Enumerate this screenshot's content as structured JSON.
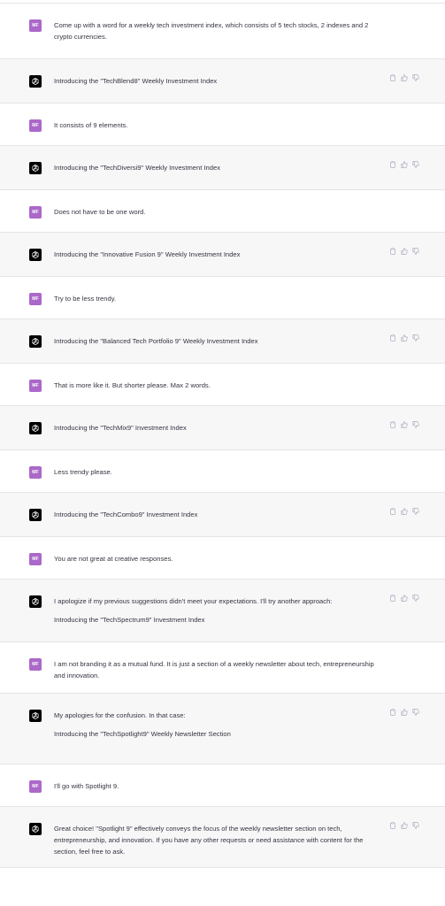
{
  "user": {
    "initials": "MF"
  },
  "icons": {
    "assistant_avatar": "openai-logo-icon",
    "copy": "clipboard-icon",
    "thumbs_up": "thumbs-up-icon",
    "thumbs_down": "thumbs-down-icon"
  },
  "colors": {
    "user_avatar": "#ab68c9",
    "assistant_avatar": "#000000",
    "assistant_background": "#f7f7f8"
  },
  "messages": [
    {
      "role": "user",
      "paragraphs": [
        "Come up with a word for a weekly tech investment index, which consists of 5 tech stocks, 2 indexes and 2 crypto currencies."
      ]
    },
    {
      "role": "assistant",
      "paragraphs": [
        "Introducing the \"TechBlend8\" Weekly Investment Index"
      ]
    },
    {
      "role": "user",
      "paragraphs": [
        "It consists of 9 elements."
      ]
    },
    {
      "role": "assistant",
      "paragraphs": [
        "Introducing the \"TechDiversi9\" Weekly Investment Index"
      ]
    },
    {
      "role": "user",
      "paragraphs": [
        "Does not have to be one word."
      ]
    },
    {
      "role": "assistant",
      "paragraphs": [
        "Introducing the \"Innovative Fusion 9\" Weekly Investment Index"
      ]
    },
    {
      "role": "user",
      "paragraphs": [
        "Try to be less trendy."
      ]
    },
    {
      "role": "assistant",
      "paragraphs": [
        "Introducing the \"Balanced Tech Portfolio 9\" Weekly Investment Index"
      ]
    },
    {
      "role": "user",
      "paragraphs": [
        "That is more like it. But shorter please. Max 2 words."
      ]
    },
    {
      "role": "assistant",
      "paragraphs": [
        "Introducing the \"TechMix9\" Investment Index"
      ]
    },
    {
      "role": "user",
      "paragraphs": [
        "Less trendy please."
      ]
    },
    {
      "role": "assistant",
      "paragraphs": [
        "Introducing the \"TechCombo9\" Investment Index"
      ]
    },
    {
      "role": "user",
      "paragraphs": [
        "You are not great at creative responses."
      ]
    },
    {
      "role": "assistant",
      "paragraphs": [
        "I apologize if my previous suggestions didn't meet your expectations. I'll try another approach:",
        "Introducing the \"TechSpectrum9\" Investment Index"
      ]
    },
    {
      "role": "user",
      "paragraphs": [
        "I am not branding it as a mutual fund. It is just a section of a weekly newsletter about tech, entrepreneurship and innovation."
      ]
    },
    {
      "role": "assistant",
      "paragraphs": [
        "My apologies for the confusion. In that case:",
        "Introducing the \"TechSpotlight9\" Weekly Newsletter Section"
      ]
    },
    {
      "role": "user",
      "paragraphs": [
        "I'll go with Spotlight 9."
      ]
    },
    {
      "role": "assistant",
      "paragraphs": [
        "Great choice! \"Spotlight 9\" effectively conveys the focus of the weekly newsletter section on tech, entrepreneurship, and innovation. If you have any other requests or need assistance with content for the section, feel free to ask."
      ]
    }
  ]
}
